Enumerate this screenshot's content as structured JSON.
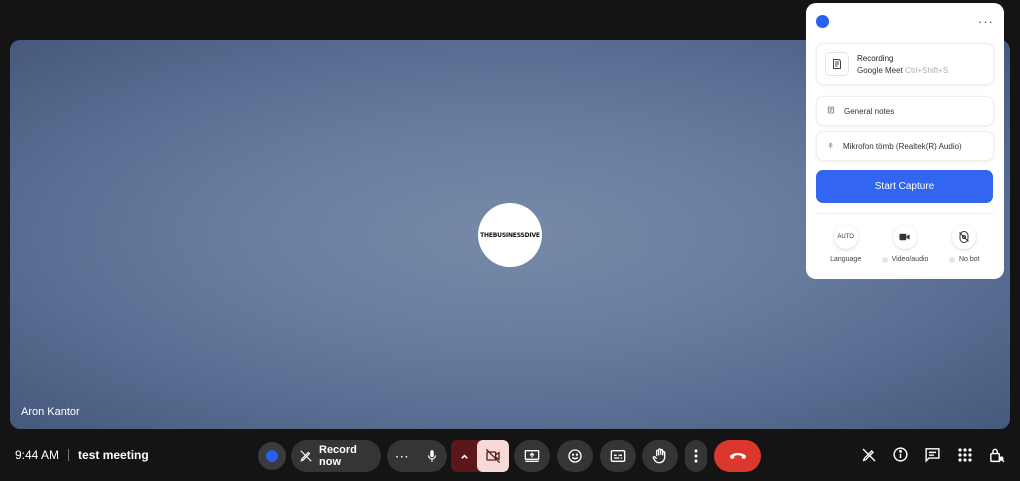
{
  "stage": {
    "avatar_text": "THEBUSINESSDIVE",
    "participant_name": "Aron Kantor"
  },
  "bottom_bar": {
    "time": "9:44 AM",
    "meeting_name": "test meeting",
    "record_label": "Record now"
  },
  "panel": {
    "recording_title": "Recording",
    "recording_source": "Google Meet",
    "recording_hotkey": "Ctrl+Shift+S",
    "notes_label": "General notes",
    "mic_label": "Mikrofon tömb (Realtek(R) Audio)",
    "start_label": "Start Capture",
    "options": [
      {
        "badge": "AUTO",
        "label": "Language"
      },
      {
        "badge": "",
        "label": "Video/audio"
      },
      {
        "badge": "",
        "label": "No bot"
      }
    ]
  },
  "colors": {
    "accent": "#3266f0",
    "hangup": "#db372d",
    "camera_off_bg": "#5b1719"
  },
  "icons": [
    "pencil-slash-icon",
    "more-horizontal-icon",
    "mic-icon",
    "chevron-up-icon",
    "camera-off-icon",
    "present-icon",
    "emoji-icon",
    "captions-icon",
    "hand-icon",
    "more-vertical-icon",
    "hangup-icon",
    "info-icon",
    "chat-icon",
    "apps-icon",
    "lock-person-icon",
    "notes-icon",
    "document-icon",
    "video-icon",
    "bot-off-icon"
  ]
}
